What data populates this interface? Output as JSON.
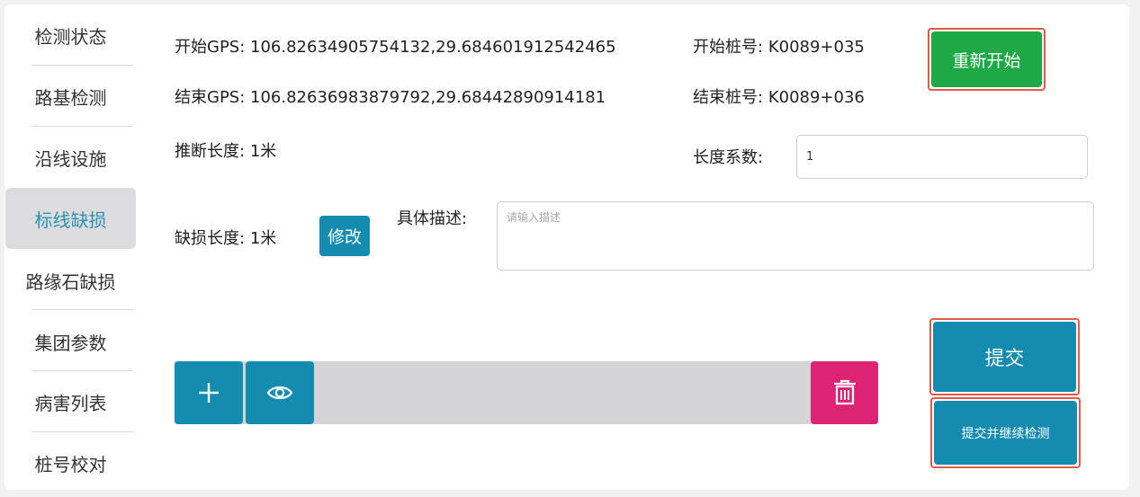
{
  "sidebar": {
    "items": [
      {
        "label": "检测状态",
        "active": false
      },
      {
        "label": "路基检测",
        "active": false
      },
      {
        "label": "沿线设施",
        "active": false
      },
      {
        "label": "标线缺损",
        "active": true
      },
      {
        "label": "路缘石缺损",
        "active": false
      },
      {
        "label": "集团参数",
        "active": false
      },
      {
        "label": "病害列表",
        "active": false
      },
      {
        "label": "桩号校对",
        "active": false
      }
    ]
  },
  "form": {
    "start_gps_label": "开始GPS:",
    "start_gps_value": "106.82634905754132,29.684601912542465",
    "end_gps_label": "结束GPS:",
    "end_gps_value": "106.82636983879792,29.68442890914181",
    "start_stake_label": "开始桩号:",
    "start_stake_value": "K0089+035",
    "end_stake_label": "结束桩号:",
    "end_stake_value": "K0089+036",
    "inferred_length_label": "推断长度:",
    "inferred_length_value": "1米",
    "length_coef_label": "长度系数:",
    "length_coef_value": "1",
    "defect_length_label": "缺损长度:",
    "defect_length_value": "1米",
    "modify_label": "修改",
    "description_label": "具体描述:",
    "description_placeholder": "请输入描述",
    "description_value": ""
  },
  "buttons": {
    "restart_label": "重新开始",
    "submit_label": "提交",
    "submit_continue_label": "提交并继续检测"
  },
  "toolbar": {
    "add_icon": "plus-icon",
    "view_icon": "eye-icon",
    "delete_icon": "trash-icon"
  },
  "colors": {
    "primary": "#148cb0",
    "restart_green": "#1ea946",
    "delete_pink": "#dc2374",
    "highlight_red": "#e25a4a",
    "active_text": "#2a93b3",
    "toolbar_gray": "#d4d4d6"
  }
}
